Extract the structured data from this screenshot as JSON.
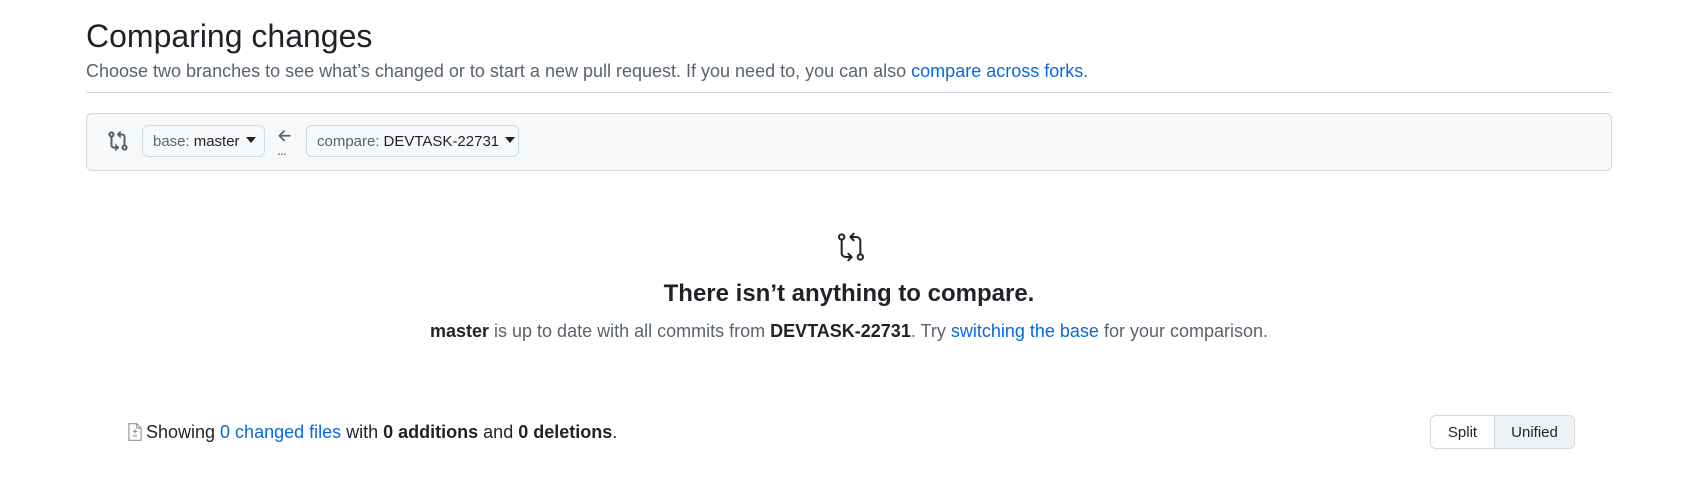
{
  "page": {
    "title": "Comparing changes",
    "subtitle_text": "Choose two branches to see what’s changed or to start a new pull request. If you need to, you can also ",
    "subtitle_link": "compare across forks",
    "subtitle_end": "."
  },
  "range": {
    "base_prefix": "base:",
    "base_branch": "master",
    "compare_prefix": "compare:",
    "compare_branch": "DEVTASK-22731",
    "dots": "..."
  },
  "blankslate": {
    "title": "There isn’t anything to compare.",
    "desc_branch1": "master",
    "desc_text1": " is up to date with all commits from ",
    "desc_branch2": "DEVTASK-22731",
    "desc_text2": ". Try ",
    "desc_link": "switching the base",
    "desc_text3": " for your comparison."
  },
  "summary": {
    "showing": "Showing ",
    "changed_files": "0 changed files",
    "with": " with ",
    "additions": "0 additions",
    "and": " and ",
    "deletions": "0 deletions",
    "end": "."
  },
  "view_toggle": {
    "split": "Split",
    "unified": "Unified"
  },
  "icons": {
    "range": "git-compare-icon",
    "arrow": "arrow-left-icon",
    "blank": "git-compare-icon",
    "file": "file-diff-icon"
  },
  "colors": {
    "link": "#0969da",
    "text": "#1f2328",
    "muted": "#59636e",
    "border": "#d1d9e0",
    "box_bg": "#f6f8fa"
  }
}
